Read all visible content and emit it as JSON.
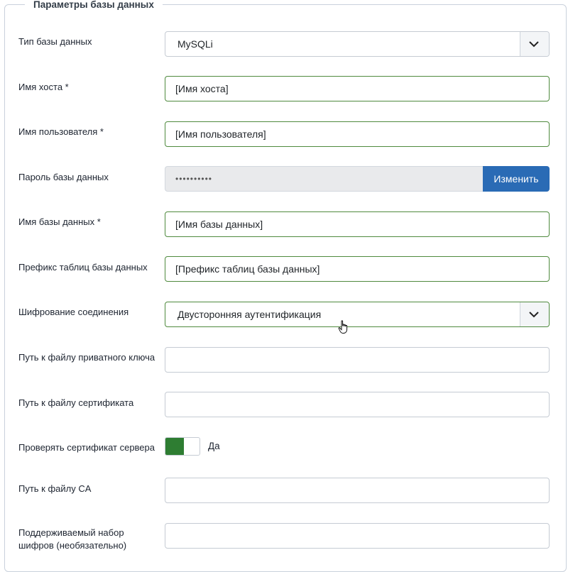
{
  "legend": "Параметры базы данных",
  "fields": {
    "db_type": {
      "label": "Тип базы данных",
      "value": "MySQLi"
    },
    "host": {
      "label": "Имя хоста *",
      "value": "[Имя хоста]"
    },
    "user": {
      "label": "Имя пользователя *",
      "value": "[Имя пользователя]"
    },
    "password": {
      "label": "Пароль базы данных",
      "value": "••••••••••",
      "button": "Изменить"
    },
    "db_name": {
      "label": "Имя базы данных *",
      "value": "[Имя базы данных]"
    },
    "prefix": {
      "label": "Префикс таблиц базы данных",
      "value": "[Префикс таблиц базы данных]"
    },
    "encryption": {
      "label": "Шифрование соединения",
      "value": "Двусторонняя аутентификация"
    },
    "key_path": {
      "label": "Путь к файлу приватного ключа",
      "value": ""
    },
    "cert_path": {
      "label": "Путь к файлу сертификата",
      "value": ""
    },
    "verify_cert": {
      "label": "Проверять сертификат сервера",
      "state": "Да"
    },
    "ca_path": {
      "label": "Путь к файлу CA",
      "value": ""
    },
    "cipher": {
      "label_line1": "Поддерживаемый набор",
      "label_line2": "шифров (необязательно)",
      "value": ""
    }
  },
  "colors": {
    "primary_button": "#2a6bb5",
    "valid_border": "#4f8a3e",
    "toggle_on": "#2e7d32"
  }
}
